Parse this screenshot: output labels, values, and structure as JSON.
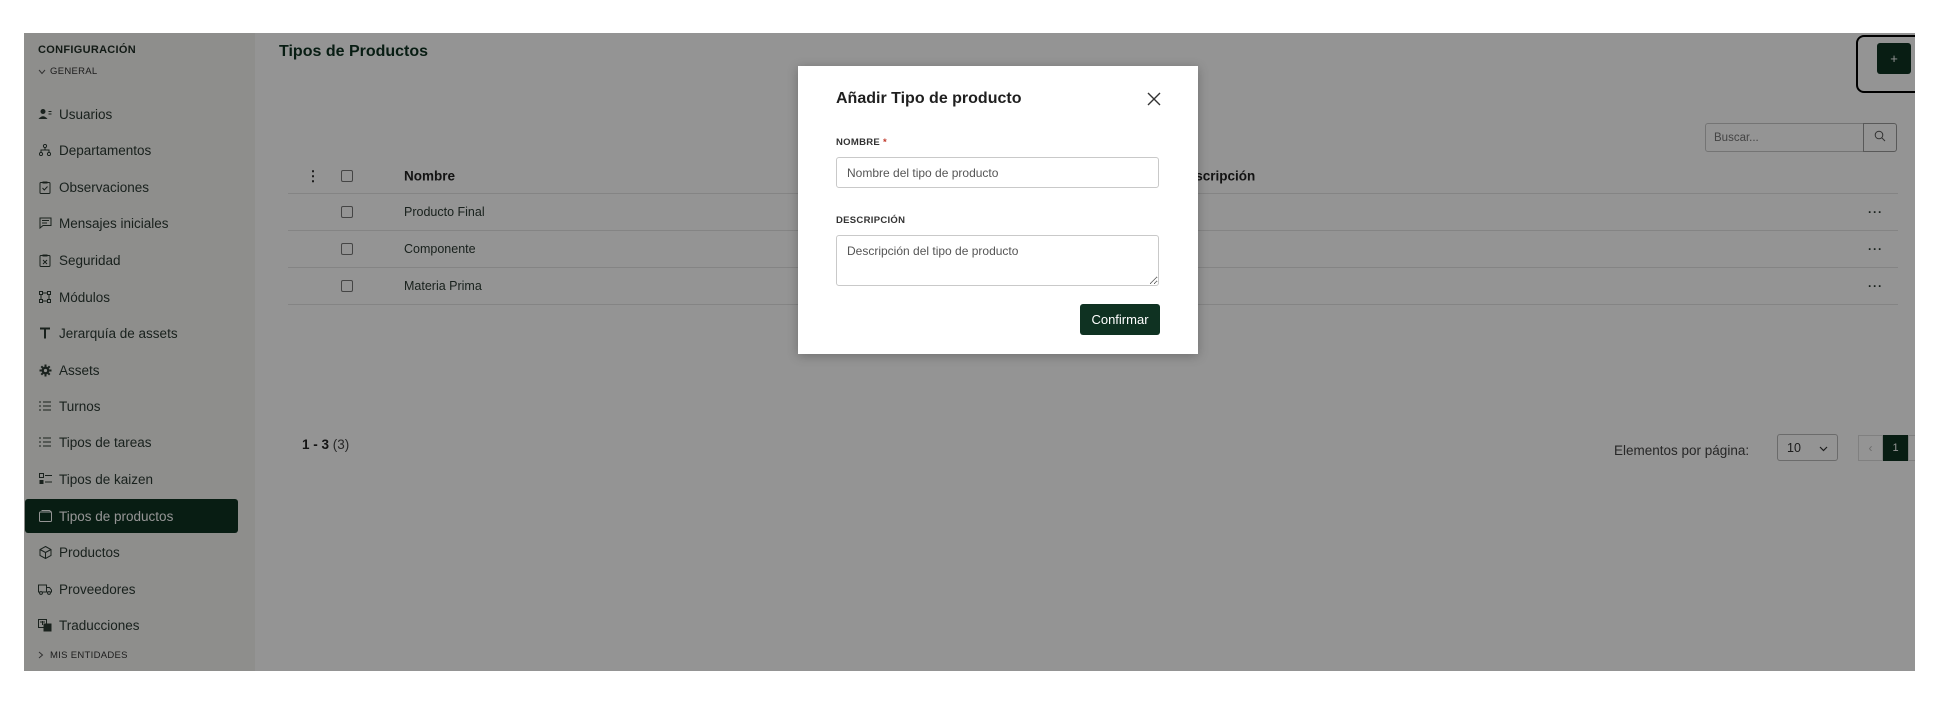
{
  "sidebar": {
    "title": "CONFIGURACIÓN",
    "group_general": "GENERAL",
    "group_mis_entidades": "MIS ENTIDADES",
    "items": [
      {
        "label": "Usuarios",
        "icon": "users-icon"
      },
      {
        "label": "Departamentos",
        "icon": "hierarchy-icon"
      },
      {
        "label": "Observaciones",
        "icon": "clipboard-check-icon"
      },
      {
        "label": "Mensajes iniciales",
        "icon": "message-icon"
      },
      {
        "label": "Seguridad",
        "icon": "shield-clipboard-icon"
      },
      {
        "label": "Módulos",
        "icon": "module-icon"
      },
      {
        "label": "Jerarquía de assets",
        "icon": "text-t-icon"
      },
      {
        "label": "Assets",
        "icon": "gear-icon"
      },
      {
        "label": "Turnos",
        "icon": "list-icon"
      },
      {
        "label": "Tipos de tareas",
        "icon": "list-icon"
      },
      {
        "label": "Tipos de kaizen",
        "icon": "checklist-icon"
      },
      {
        "label": "Tipos de productos",
        "icon": "box-icon",
        "active": true
      },
      {
        "label": "Productos",
        "icon": "package-icon"
      },
      {
        "label": "Proveedores",
        "icon": "truck-icon"
      },
      {
        "label": "Traducciones",
        "icon": "translate-icon"
      }
    ]
  },
  "main": {
    "title": "Tipos de Productos",
    "add_button_label": "+",
    "search_placeholder": "Buscar...",
    "table": {
      "headers": {
        "name": "Nombre",
        "description": "Descripción"
      },
      "rows": [
        {
          "name": "Producto Final",
          "description": ""
        },
        {
          "name": "Componente",
          "description": ""
        },
        {
          "name": "Materia Prima",
          "description": ""
        }
      ],
      "row_menu": "···"
    },
    "pagination": {
      "range": "1 - 3",
      "total": "(3)",
      "per_page_label": "Elementos por página:",
      "per_page_value": "10",
      "current_page": "1"
    }
  },
  "modal": {
    "title": "Añadir Tipo de producto",
    "name_label": "NOMBRE",
    "required_mark": "*",
    "name_placeholder": "Nombre del tipo de producto",
    "description_label": "DESCRIPCIÓN",
    "description_placeholder": "Descripción del tipo de producto",
    "confirm_label": "Confirmar"
  },
  "colors": {
    "brand_dark_green": "#0f3222",
    "overlay": "rgba(0,0,0,0.42)",
    "required": "#c0392b"
  }
}
